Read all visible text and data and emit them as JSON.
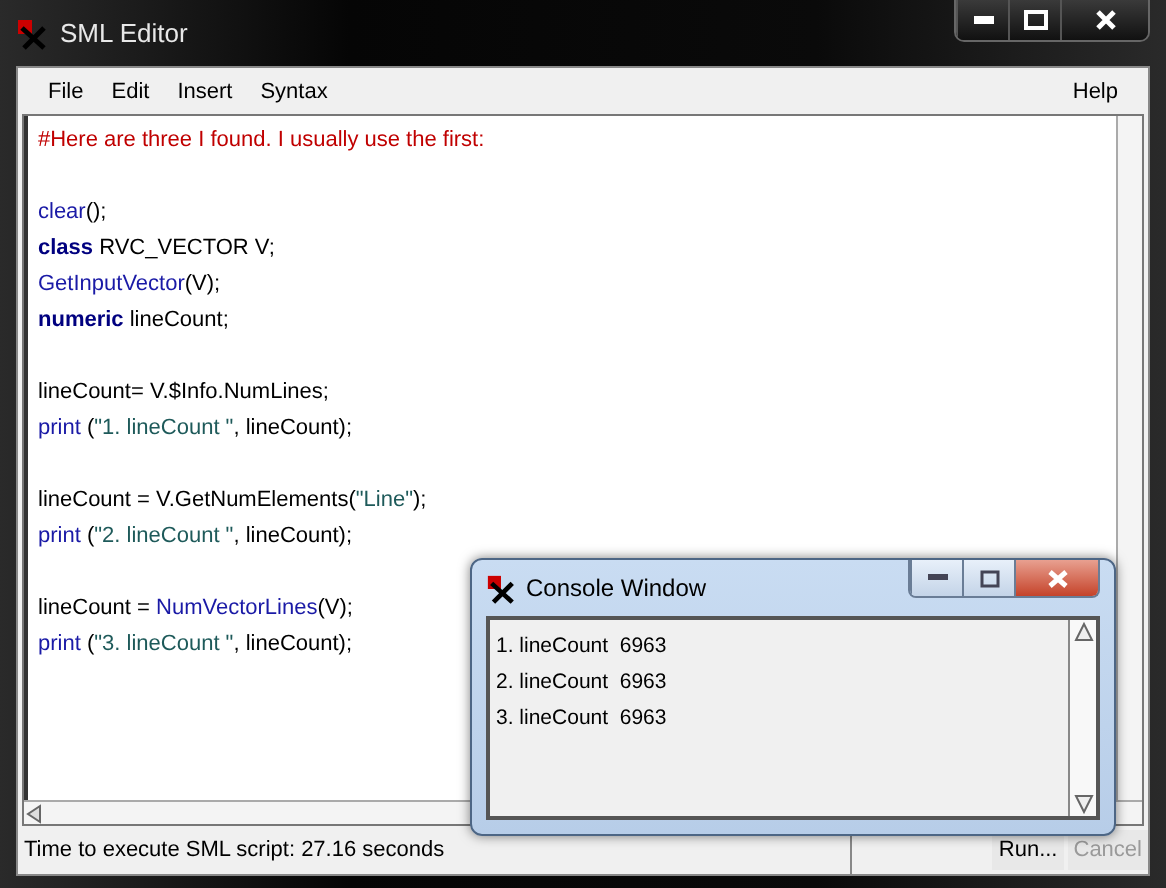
{
  "window": {
    "title": "SML Editor"
  },
  "menu": {
    "left": [
      "File",
      "Edit",
      "Insert",
      "Syntax"
    ],
    "right": [
      "Help"
    ]
  },
  "editor": {
    "blocks": [
      [
        [
          {
            "kind": "comment",
            "text": "#Here are three I found. I usually use the first:"
          }
        ]
      ],
      [
        [
          {
            "kind": "function",
            "text": "clear"
          },
          {
            "kind": "plain",
            "text": "();"
          }
        ],
        [
          {
            "kind": "keyword",
            "text": "class"
          },
          {
            "kind": "plain",
            "text": " RVC_VECTOR V;"
          }
        ],
        [
          {
            "kind": "function",
            "text": "GetInputVector"
          },
          {
            "kind": "plain",
            "text": "(V);"
          }
        ],
        [
          {
            "kind": "keyword",
            "text": "numeric"
          },
          {
            "kind": "plain",
            "text": " lineCount;"
          }
        ]
      ],
      [
        [
          {
            "kind": "plain",
            "text": "lineCount= V.$Info.NumLines;"
          }
        ],
        [
          {
            "kind": "function",
            "text": "print"
          },
          {
            "kind": "plain",
            "text": " ("
          },
          {
            "kind": "string",
            "text": "\"1. lineCount \""
          },
          {
            "kind": "plain",
            "text": ", lineCount);"
          }
        ]
      ],
      [
        [
          {
            "kind": "plain",
            "text": "lineCount = V.GetNumElements("
          },
          {
            "kind": "string",
            "text": "\"Line\""
          },
          {
            "kind": "plain",
            "text": ");"
          }
        ],
        [
          {
            "kind": "function",
            "text": "print"
          },
          {
            "kind": "plain",
            "text": " ("
          },
          {
            "kind": "string",
            "text": "\"2. lineCount \""
          },
          {
            "kind": "plain",
            "text": ", lineCount);"
          }
        ]
      ],
      [
        [
          {
            "kind": "plain",
            "text": "lineCount = "
          },
          {
            "kind": "function",
            "text": "NumVectorLines"
          },
          {
            "kind": "plain",
            "text": "(V);"
          }
        ],
        [
          {
            "kind": "function",
            "text": "print"
          },
          {
            "kind": "plain",
            "text": " ("
          },
          {
            "kind": "string",
            "text": "\"3. lineCount \""
          },
          {
            "kind": "plain",
            "text": ", lineCount);"
          }
        ]
      ]
    ]
  },
  "status_bar": {
    "text": "Time to execute SML script: 27.16 seconds",
    "buttons": [
      {
        "label": "Run...",
        "disabled": false
      },
      {
        "label": "Cancel",
        "disabled": true
      }
    ]
  },
  "console": {
    "title": "Console Window",
    "lines": [
      "1. lineCount  6963",
      "2. lineCount  6963",
      "3. lineCount  6963"
    ]
  }
}
